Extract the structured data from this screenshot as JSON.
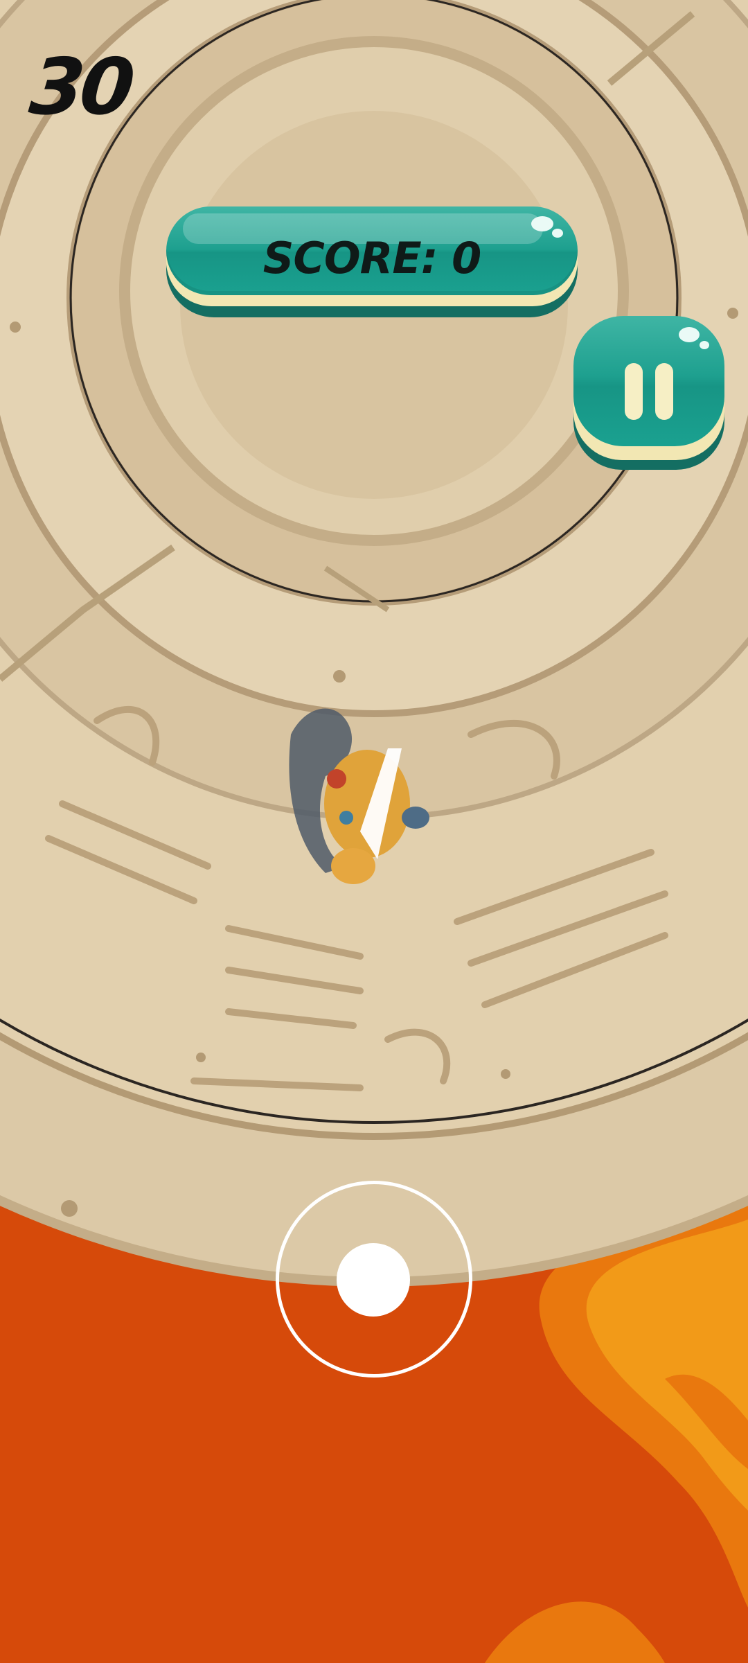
{
  "hud": {
    "timer": "30",
    "score_text": "SCORE: 0"
  },
  "icons": {
    "pause": "pause-icon",
    "joystick": "virtual-joystick"
  },
  "colors": {
    "lava_dark": "#d64a0a",
    "lava_light": "#f29a18",
    "stone": "#d6c2a0",
    "button_teal": "#1ea08f",
    "button_cream": "#f2e7b3"
  }
}
